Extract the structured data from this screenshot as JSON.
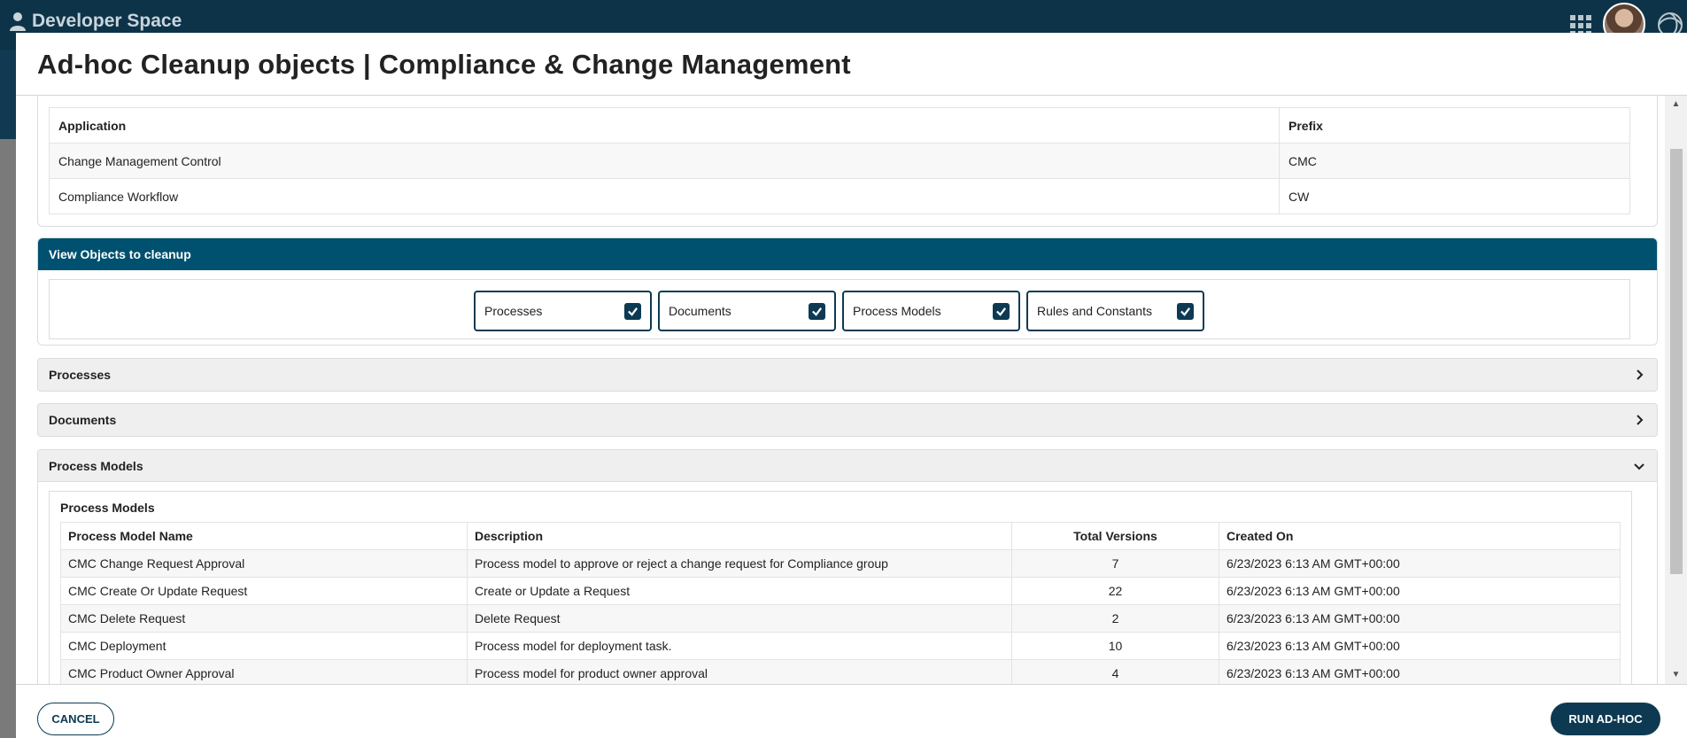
{
  "app": {
    "brand": "Developer Space",
    "icons": {
      "brand": "user-icon",
      "apps": "app-grid-icon",
      "logo": "swirl-logo-icon"
    }
  },
  "modal": {
    "title": "Ad-hoc Cleanup objects | Compliance & Change Management",
    "applications": {
      "headers": [
        "Application",
        "Prefix"
      ],
      "rows": [
        [
          "Change Management Control",
          "CMC"
        ],
        [
          "Compliance Workflow",
          "CW"
        ]
      ]
    },
    "view_objects": {
      "title": "View Objects to cleanup",
      "options": [
        {
          "label": "Processes",
          "checked": true
        },
        {
          "label": "Documents",
          "checked": true
        },
        {
          "label": "Process Models",
          "checked": true
        },
        {
          "label": "Rules and Constants",
          "checked": true
        }
      ]
    },
    "sections": {
      "processes": {
        "label": "Processes",
        "expanded": false
      },
      "documents": {
        "label": "Documents",
        "expanded": false
      },
      "process_models": {
        "label": "Process Models",
        "expanded": true,
        "caption": "Process Models",
        "headers": [
          "Process Model Name",
          "Description",
          "Total Versions",
          "Created On"
        ],
        "rows": [
          [
            "CMC Change Request Approval",
            "Process model to approve or reject a change request for Compliance group",
            "7",
            "6/23/2023 6:13 AM GMT+00:00"
          ],
          [
            "CMC Create Or Update Request",
            "Create or Update a Request",
            "22",
            "6/23/2023 6:13 AM GMT+00:00"
          ],
          [
            "CMC Delete Request",
            "Delete Request",
            "2",
            "6/23/2023 6:13 AM GMT+00:00"
          ],
          [
            "CMC Deployment",
            "Process model for deployment task.",
            "10",
            "6/23/2023 6:13 AM GMT+00:00"
          ],
          [
            "CMC Product Owner Approval",
            "Process model for product owner approval",
            "4",
            "6/23/2023 6:13 AM GMT+00:00"
          ]
        ]
      }
    },
    "footer": {
      "cancel_label": "CANCEL",
      "run_label": "RUN AD-HOC"
    }
  },
  "colors": {
    "header_bg": "#0d3349",
    "accent": "#00506f",
    "button": "#0d3a52"
  }
}
